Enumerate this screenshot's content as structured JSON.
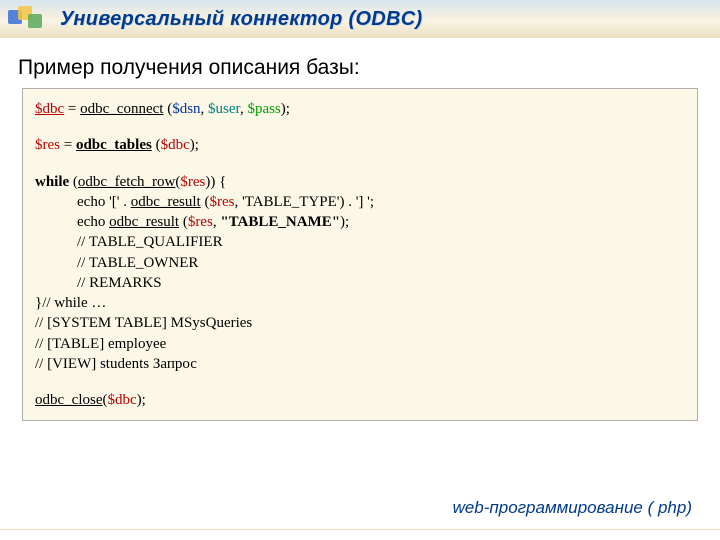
{
  "header": {
    "title": "Универсальный коннектор (ODBC)"
  },
  "subtitle": "Пример получения описания базы:",
  "code": {
    "l1": {
      "v_dbc": "$dbc",
      "eq": " = ",
      "fn": "odbc_connect",
      "open": " (",
      "v_dsn": "$dsn",
      "c1": ", ",
      "v_user": "$user",
      "c2": ", ",
      "v_pass": "$pass",
      "close": "); "
    },
    "l2": {
      "v_res": "$res",
      "eq": " = ",
      "fn": "odbc_tables",
      "open": " (",
      "v_dbc": "$dbc",
      "close": "); "
    },
    "l3": {
      "kw": "while",
      "open": " (",
      "fn": "odbc_fetch_row",
      "op2": "(",
      "v_res": "$res",
      "close": ")) {"
    },
    "l4": {
      "pre": "echo '[' . ",
      "fn": "odbc_result",
      "open": " (",
      "v_res": "$res",
      "c": ", ",
      "arg": "'TABLE_TYPE'",
      "close": ") . '] ';"
    },
    "l5": {
      "pre": "echo ",
      "fn": "odbc_result",
      "open": " (",
      "v_res": "$res",
      "c": ", ",
      "arg": "\"TABLE_NAME\"",
      "close": ");"
    },
    "l6": "// TABLE_QUALIFIER",
    "l7": "// TABLE_OWNER",
    "l8": "// REMARKS",
    "l9": "}// while …",
    "l10": "// [SYSTEM TABLE] MSysQueries",
    "l11": "// [TABLE] employee",
    "l12": "// [VIEW] students Запрос",
    "l13": {
      "fn": "odbc_close",
      "open": "(",
      "v_dbc": "$dbc",
      "close": ");"
    }
  },
  "footer": "web-программирование ( php)"
}
